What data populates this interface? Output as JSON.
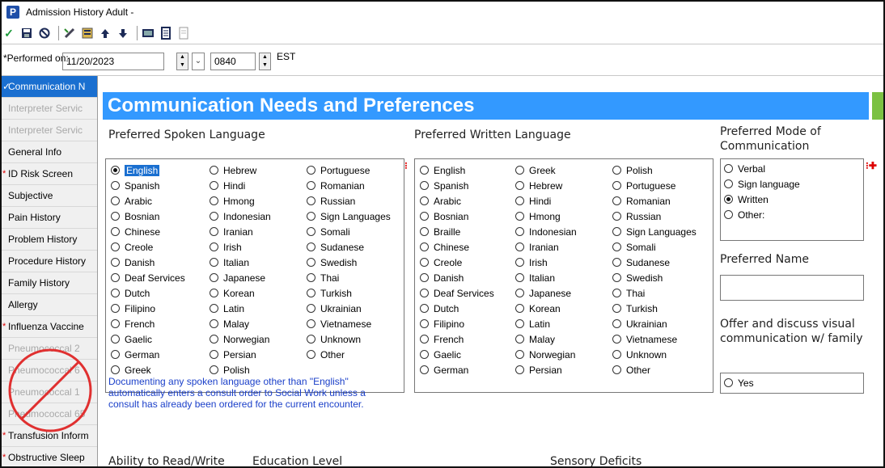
{
  "window": {
    "title": "Admission History Adult -",
    "app_icon_letter": "P"
  },
  "toolbar": {
    "icons": [
      "check-icon",
      "save-icon",
      "cancel-icon",
      "edit-icon",
      "form-icon",
      "up-arrow-icon",
      "down-arrow-icon",
      "calculator-icon",
      "notes-icon",
      "print-icon"
    ]
  },
  "performed": {
    "label": "*Performed on:",
    "date": "11/20/2023",
    "time": "0840",
    "timezone": "EST"
  },
  "sidebar": {
    "items": [
      {
        "label": "Communication N",
        "state": "active",
        "required": false
      },
      {
        "label": "Interpreter Servic",
        "state": "disabled",
        "required": false
      },
      {
        "label": "Interpreter Servic",
        "state": "disabled",
        "required": false
      },
      {
        "label": "General Info",
        "state": "normal",
        "required": false
      },
      {
        "label": "ID Risk Screen",
        "state": "normal",
        "required": true
      },
      {
        "label": "Subjective",
        "state": "normal",
        "required": false
      },
      {
        "label": "Pain History",
        "state": "normal",
        "required": false
      },
      {
        "label": "Problem History",
        "state": "normal",
        "required": false
      },
      {
        "label": "Procedure History",
        "state": "normal",
        "required": false
      },
      {
        "label": "Family History",
        "state": "normal",
        "required": false
      },
      {
        "label": "Allergy",
        "state": "normal",
        "required": false
      },
      {
        "label": "Influenza Vaccine",
        "state": "normal",
        "required": true
      },
      {
        "label": "Pneumococcal 2",
        "state": "disabled",
        "required": false
      },
      {
        "label": "Pneumococcal 6",
        "state": "disabled",
        "required": false
      },
      {
        "label": "Pneumococcal 1",
        "state": "disabled",
        "required": false
      },
      {
        "label": "Pneumococcal 65",
        "state": "disabled",
        "required": false
      },
      {
        "label": "Transfusion Inform",
        "state": "normal",
        "required": true
      },
      {
        "label": "Obstructive Sleep",
        "state": "normal",
        "required": true
      }
    ]
  },
  "main": {
    "banner": "Communication Needs and Preferences",
    "spoken": {
      "label": "Preferred Spoken Language",
      "selected": "English",
      "columns": [
        [
          "English",
          "Spanish",
          "Arabic",
          "Bosnian",
          "Chinese",
          "Creole",
          "Danish",
          "Deaf Services",
          "Dutch",
          "Filipino",
          "French",
          "Gaelic",
          "German",
          "Greek"
        ],
        [
          "Hebrew",
          "Hindi",
          "Hmong",
          "Indonesian",
          "Iranian",
          "Irish",
          "Italian",
          "Japanese",
          "Korean",
          "Latin",
          "Malay",
          "Norwegian",
          "Persian",
          "Polish"
        ],
        [
          "Portuguese",
          "Romanian",
          "Russian",
          "Sign Languages",
          "Somali",
          "Sudanese",
          "Swedish",
          "Thai",
          "Turkish",
          "Ukrainian",
          "Vietnamese",
          "Unknown",
          "Other"
        ]
      ]
    },
    "written": {
      "label": "Preferred Written Language",
      "columns": [
        [
          "English",
          "Spanish",
          "Arabic",
          "Bosnian",
          "Braille",
          "Chinese",
          "Creole",
          "Danish",
          "Deaf Services",
          "Dutch",
          "Filipino",
          "French",
          "Gaelic",
          "German"
        ],
        [
          "Greek",
          "Hebrew",
          "Hindi",
          "Hmong",
          "Indonesian",
          "Iranian",
          "Irish",
          "Italian",
          "Japanese",
          "Korean",
          "Latin",
          "Malay",
          "Norwegian",
          "Persian"
        ],
        [
          "Polish",
          "Portuguese",
          "Romanian",
          "Russian",
          "Sign Languages",
          "Somali",
          "Sudanese",
          "Swedish",
          "Thai",
          "Turkish",
          "Ukrainian",
          "Vietnamese",
          "Unknown",
          "Other"
        ]
      ]
    },
    "mode": {
      "label": "Preferred Mode of Communication",
      "selected": "Written",
      "options": [
        "Verbal",
        "Sign language",
        "Written",
        "Other:"
      ]
    },
    "preferred_name": {
      "label": "Preferred Name",
      "value": ""
    },
    "visual": {
      "label": "Offer and discuss visual communication w/ family",
      "options": [
        "Yes"
      ]
    },
    "note": "Documenting any spoken language other than \"English\" automatically enters a consult order to Social Work unless a consult has already been ordered for the current encounter.",
    "bottom_labels": {
      "read_write": "Ability to Read/Write",
      "education": "Education Level",
      "sensory": "Sensory Deficits"
    }
  }
}
